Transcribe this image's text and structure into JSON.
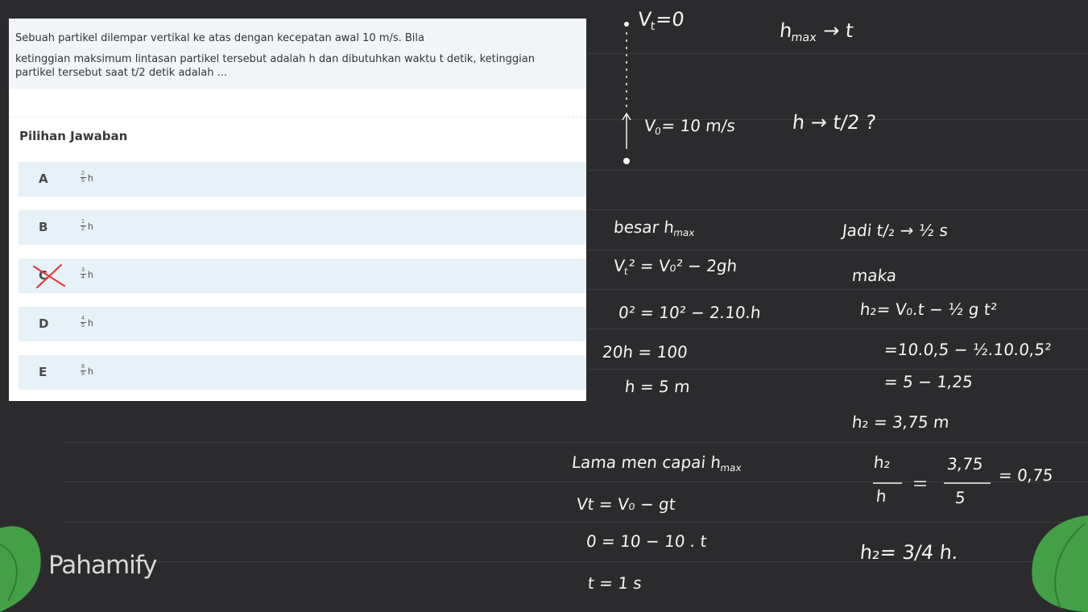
{
  "question": {
    "line1": "Sebuah partikel dilempar vertikal ke atas dengan kecepatan awal 10 m/s. Bila",
    "line2": "ketinggian maksimum lintasan partikel tersebut adalah h dan dibutuhkan waktu t detik, ketinggian",
    "line3": "partikel tersebut saat t/2 detik adalah ..."
  },
  "answers": {
    "title": "Pilihan Jawaban",
    "options": [
      {
        "letter": "A",
        "num": "2",
        "den": "5",
        "var": "h"
      },
      {
        "letter": "B",
        "num": "1",
        "den": "2",
        "var": "h"
      },
      {
        "letter": "C",
        "num": "3",
        "den": "4",
        "var": "h",
        "crossed": true
      },
      {
        "letter": "D",
        "num": "4",
        "den": "5",
        "var": "h"
      },
      {
        "letter": "E",
        "num": "8",
        "den": "9",
        "var": "h"
      }
    ]
  },
  "handwriting": {
    "vt0": "V",
    "vt0_sub": "t",
    "vt0_rest": "=0",
    "hmax_t": "h",
    "hmax_t_sub": "max",
    "hmax_t_rest": "→  t",
    "v0": "V",
    "v0_sub": "0",
    "v0_rest": "= 10 m/s",
    "h_t2": "h → t/2  ?",
    "besar": "besar h",
    "besar_sub": "max",
    "eq1_a": "V",
    "eq1_a_sub": "t",
    "eq1_rest": "² = V₀² − 2gh",
    "eq2": "0² = 10² − 2.10.h",
    "eq3": "20h = 100",
    "eq4": "h = 5 m",
    "jadi": "Jadi t/₂ → ½ s",
    "maka": "maka",
    "r1": "h₂= V₀.t − ½ g t²",
    "r2": "=10.0,5 − ½.10.0,5²",
    "r3": "= 5 − 1,25",
    "r4": "h₂ = 3,75 m",
    "lama": "Lama men capai h",
    "lama_sub": "max",
    "l1": "Vt = V₀ − gt",
    "l2": "0 = 10 − 10 . t",
    "l3": "t = 1 s",
    "ratio_a": "h₂",
    "ratio_b": "h",
    "ratio_c": "3,75",
    "ratio_d": "5",
    "ratio_e": "= 0,75",
    "final": "h₂= 3/4 h."
  },
  "brand": {
    "logo": "Pahamify"
  },
  "colors": {
    "board": "#2b2b2d",
    "option_bg": "#e7f1f8",
    "cross": "#e53935",
    "leaf": "#4caf50"
  }
}
